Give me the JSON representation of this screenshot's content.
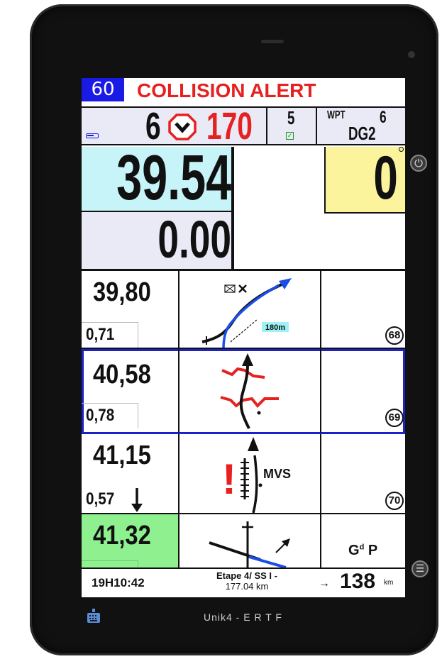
{
  "colors": {
    "speed_limit_bg": "#1a1ae6",
    "alert_red": "#e52121",
    "distance_bg": "#c7f4f8",
    "cap_bg": "#fbf49c",
    "next_bg": "#8ff08f",
    "active_outline": "#1a22c8"
  },
  "header": {
    "speed_limit": "60",
    "alert_text": "COLLISION ALERT"
  },
  "status": {
    "battery_icon": "battery-low-icon",
    "collision_count": "6",
    "warning_icon": "chevron-octagon-warning-icon",
    "collision_speed": "170",
    "satellites": "5",
    "satellite_check_icon": "check-icon",
    "wpt_label": "WPT",
    "wpt_number": "6",
    "wpt_name": "DG2"
  },
  "odometer": {
    "total": "39.54",
    "partial": "0.00",
    "cap": "0"
  },
  "roadbook": [
    {
      "distance": "39,80",
      "partial": "0,71",
      "number": "68",
      "drawing_label": "180m",
      "drawing_icon": "envelope-icon"
    },
    {
      "distance": "40,58",
      "partial": "0,78",
      "number": "69"
    },
    {
      "distance": "41,15",
      "partial": "0,57",
      "number": "70",
      "drawing_label": "MVS",
      "drawing_mark": "!"
    },
    {
      "distance": "41,32",
      "note": "GdP",
      "note_main": "G",
      "note_sup": "d",
      "note_end": "P"
    }
  ],
  "footer": {
    "clock": "19H10:42",
    "stage_line1": "Etape 4/ SS I -",
    "stage_line2": "177.04 km",
    "arrow": "→",
    "km_remaining": "138",
    "km_unit": "km"
  },
  "device": {
    "brand_text": "Unik4 - E R T F",
    "power_icon": "power-icon",
    "menu_icon": "menu-icon",
    "keyboard_icon": "keyboard-icon"
  }
}
